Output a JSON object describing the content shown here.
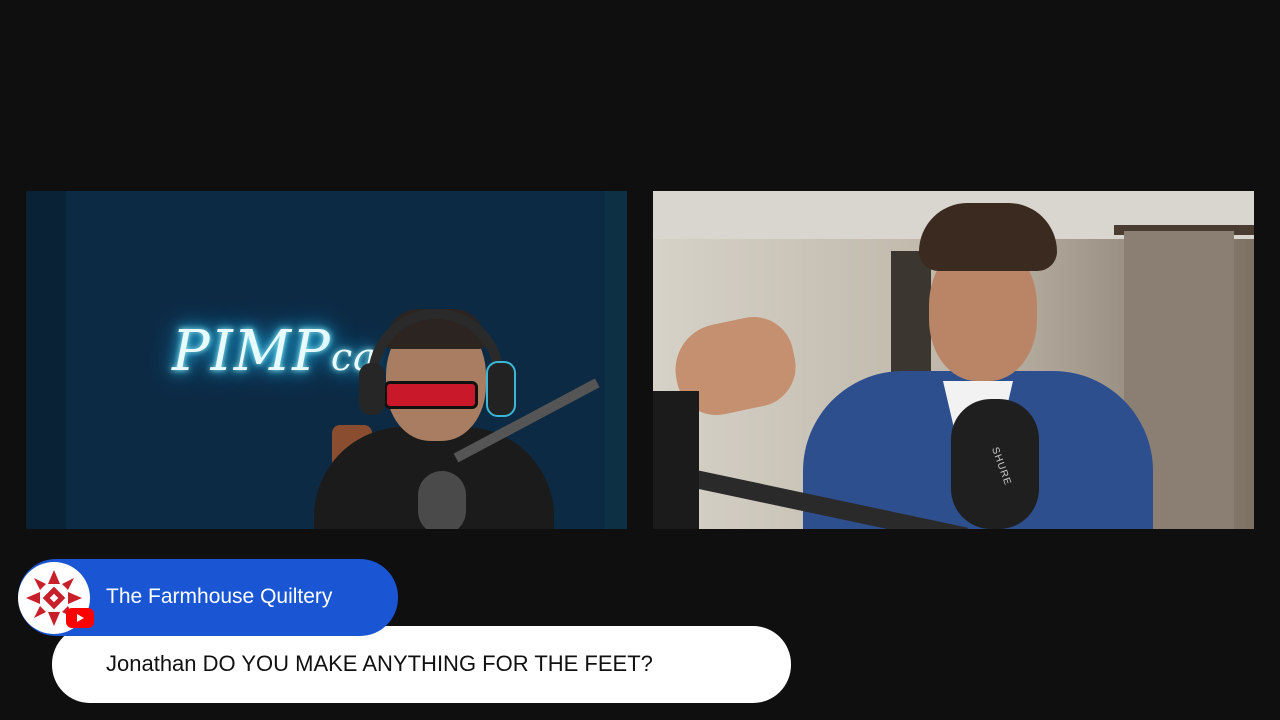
{
  "video": {
    "left_feed": {
      "neon_sign_main": "PIMP",
      "neon_sign_tail": "ca"
    },
    "right_feed": {
      "mic_brand": "SHURE"
    }
  },
  "chat": {
    "author": "The Farmhouse Quiltery",
    "message": "Jonathan DO YOU MAKE ANYTHING FOR THE FEET?",
    "author_bg_color": "#1a55d4",
    "badge_icon": "youtube-icon",
    "avatar_icon": "quilt-star-icon"
  }
}
